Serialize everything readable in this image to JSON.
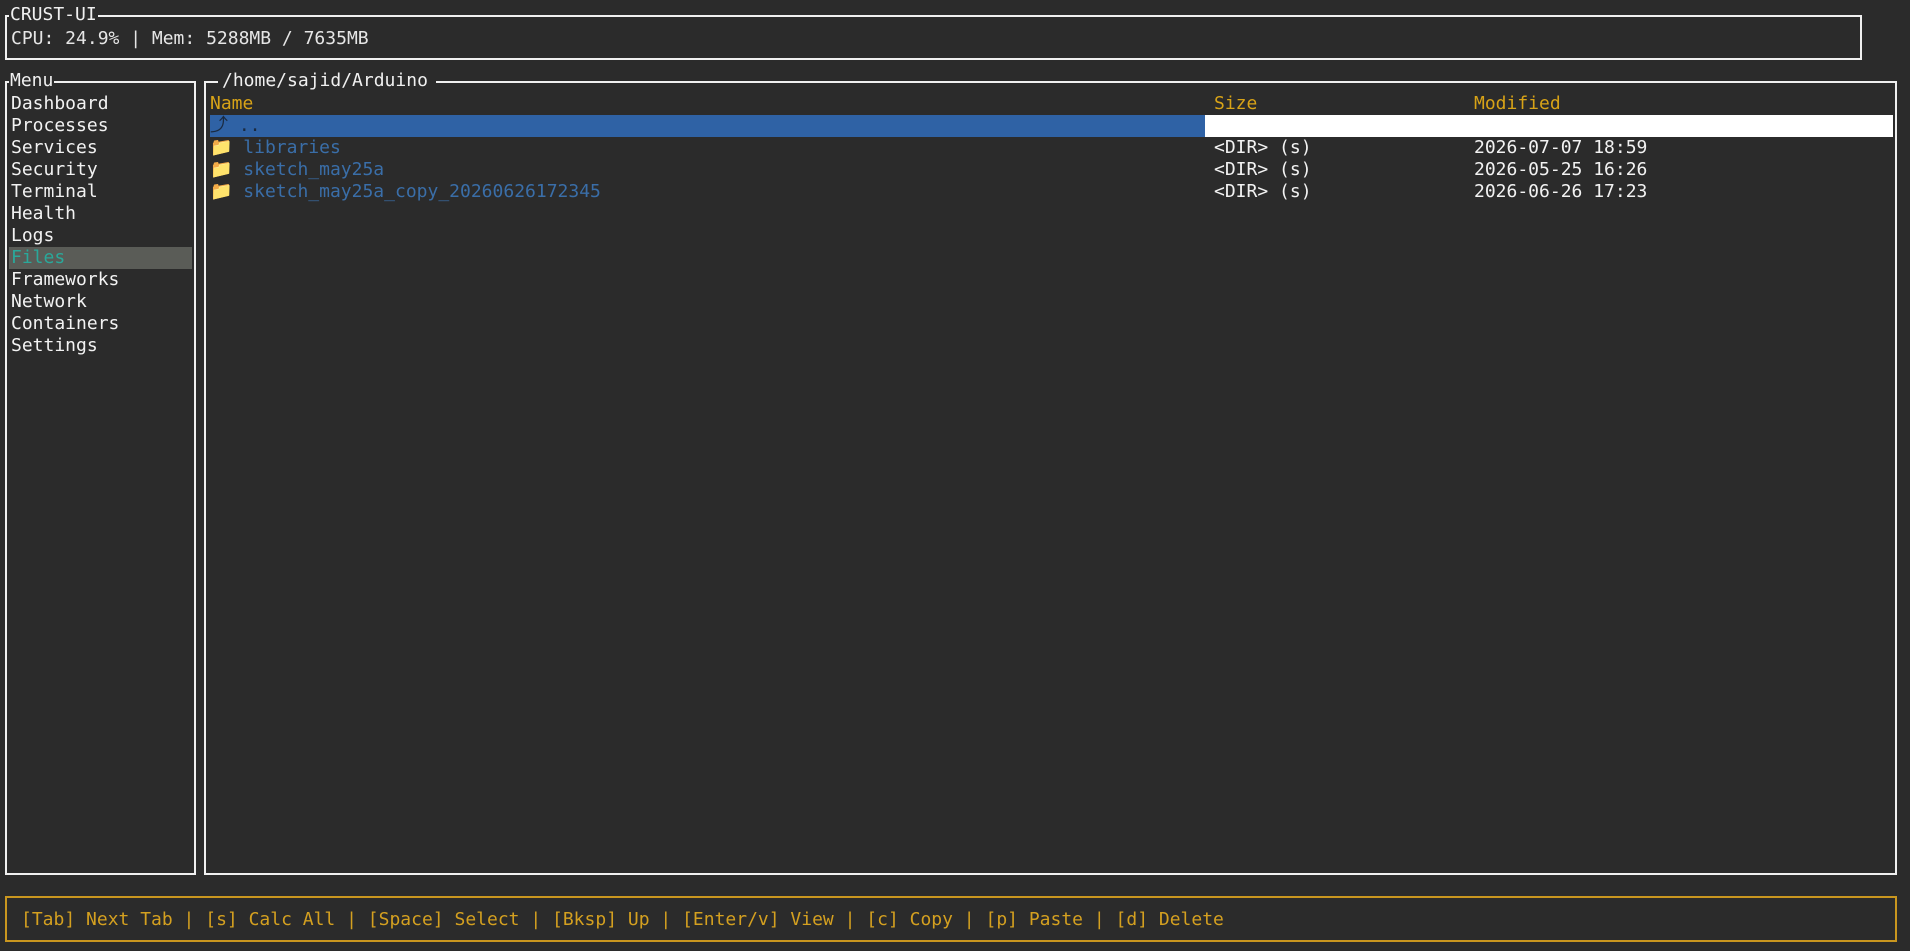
{
  "header": {
    "title": "CRUST-UI",
    "sysinfo": "CPU: 24.9% | Mem: 5288MB / 7635MB"
  },
  "sidebar": {
    "title": "Menu",
    "items": [
      {
        "label": "Dashboard"
      },
      {
        "label": "Processes"
      },
      {
        "label": "Services"
      },
      {
        "label": "Security"
      },
      {
        "label": "Terminal"
      },
      {
        "label": "Health"
      },
      {
        "label": "Logs"
      },
      {
        "label": "Files"
      },
      {
        "label": "Frameworks"
      },
      {
        "label": "Network"
      },
      {
        "label": "Containers"
      },
      {
        "label": "Settings"
      }
    ],
    "active": "Files"
  },
  "files": {
    "path": "/home/sajid/Arduino",
    "columns": {
      "name": "Name",
      "size": "Size",
      "modified": "Modified"
    },
    "rows": [
      {
        "icon": "⤴",
        "name": "..",
        "size": "",
        "modified": "",
        "selected": true
      },
      {
        "icon": "📁",
        "name": "libraries",
        "size": "<DIR> (s)",
        "modified": "2026-07-07 18:59"
      },
      {
        "icon": "📁",
        "name": "sketch_may25a",
        "size": "<DIR> (s)",
        "modified": "2026-05-25 16:26"
      },
      {
        "icon": "📁",
        "name": "sketch_may25a_copy_20260626172345",
        "size": "<DIR> (s)",
        "modified": "2026-06-26 17:23"
      }
    ]
  },
  "footer": {
    "keybinds": "[Tab] Next Tab | [s] Calc All | [Space] Select | [Bksp] Up | [Enter/v] View | [c] Copy | [p] Paste | [d] Delete"
  },
  "colors": {
    "background": "#2b2b2b",
    "accent_yellow": "#d8a317",
    "selection_blue": "#2f62a5",
    "active_menu_bg": "#5a5c57",
    "active_menu_fg": "#2aa89a",
    "folder_name": "#3a6ea8"
  }
}
